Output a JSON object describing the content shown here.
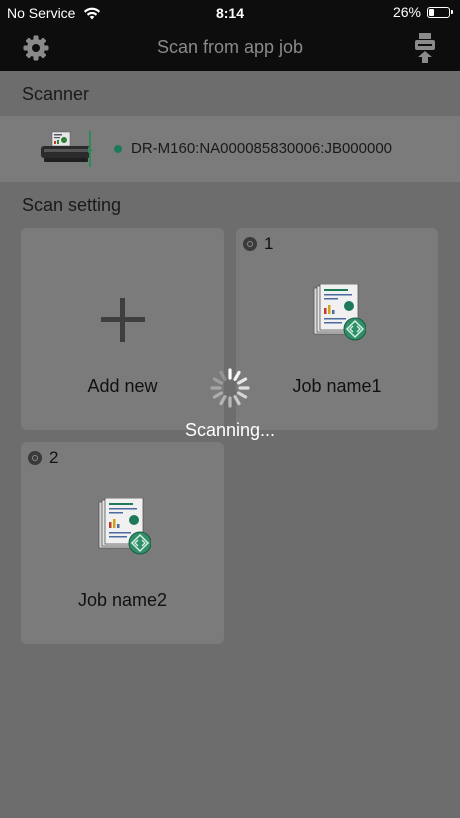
{
  "status_bar": {
    "carrier": "No Service",
    "time": "8:14",
    "battery_percent": "26%",
    "battery_level": 0.26
  },
  "nav": {
    "title": "Scan from app job",
    "left_icon": "gear-icon",
    "right_icon": "scanner-icon"
  },
  "scanner_section": {
    "header": "Scanner",
    "device_name": "DR-M160:NA000085830006:JB000000",
    "status_color": "#1d7a58"
  },
  "scan_setting": {
    "header": "Scan setting",
    "add_new_label": "Add new",
    "jobs": [
      {
        "number": "1",
        "name": "Job name1"
      },
      {
        "number": "2",
        "name": "Job name2"
      }
    ]
  },
  "overlay": {
    "text": "Scanning..."
  },
  "colors": {
    "background_dimmed": "#6d6d6d",
    "tile": "#7b7b7b",
    "bar": "#0d0d0d",
    "accent_green": "#1d7a58"
  }
}
